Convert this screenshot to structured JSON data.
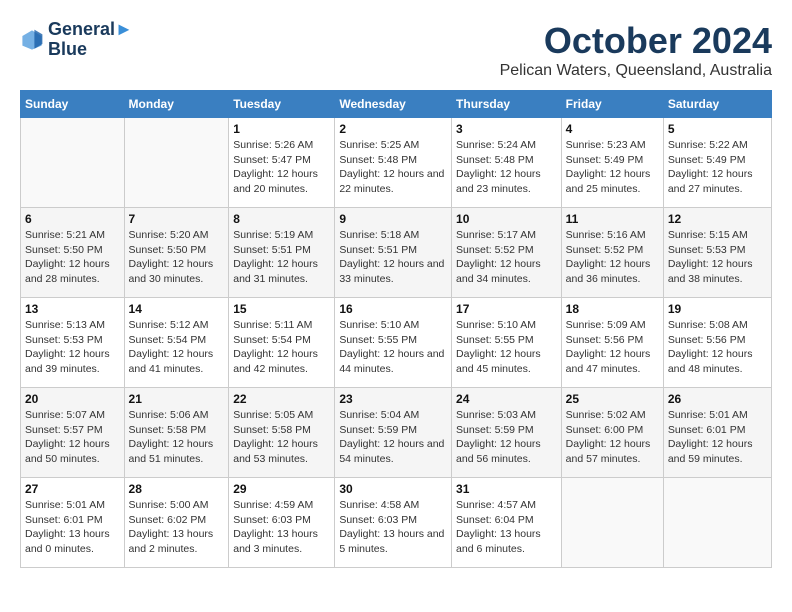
{
  "logo": {
    "line1": "General",
    "line2": "Blue"
  },
  "title": "October 2024",
  "location": "Pelican Waters, Queensland, Australia",
  "weekdays": [
    "Sunday",
    "Monday",
    "Tuesday",
    "Wednesday",
    "Thursday",
    "Friday",
    "Saturday"
  ],
  "weeks": [
    [
      {
        "day": "",
        "sunrise": "",
        "sunset": "",
        "daylight": ""
      },
      {
        "day": "",
        "sunrise": "",
        "sunset": "",
        "daylight": ""
      },
      {
        "day": "1",
        "sunrise": "Sunrise: 5:26 AM",
        "sunset": "Sunset: 5:47 PM",
        "daylight": "Daylight: 12 hours and 20 minutes."
      },
      {
        "day": "2",
        "sunrise": "Sunrise: 5:25 AM",
        "sunset": "Sunset: 5:48 PM",
        "daylight": "Daylight: 12 hours and 22 minutes."
      },
      {
        "day": "3",
        "sunrise": "Sunrise: 5:24 AM",
        "sunset": "Sunset: 5:48 PM",
        "daylight": "Daylight: 12 hours and 23 minutes."
      },
      {
        "day": "4",
        "sunrise": "Sunrise: 5:23 AM",
        "sunset": "Sunset: 5:49 PM",
        "daylight": "Daylight: 12 hours and 25 minutes."
      },
      {
        "day": "5",
        "sunrise": "Sunrise: 5:22 AM",
        "sunset": "Sunset: 5:49 PM",
        "daylight": "Daylight: 12 hours and 27 minutes."
      }
    ],
    [
      {
        "day": "6",
        "sunrise": "Sunrise: 5:21 AM",
        "sunset": "Sunset: 5:50 PM",
        "daylight": "Daylight: 12 hours and 28 minutes."
      },
      {
        "day": "7",
        "sunrise": "Sunrise: 5:20 AM",
        "sunset": "Sunset: 5:50 PM",
        "daylight": "Daylight: 12 hours and 30 minutes."
      },
      {
        "day": "8",
        "sunrise": "Sunrise: 5:19 AM",
        "sunset": "Sunset: 5:51 PM",
        "daylight": "Daylight: 12 hours and 31 minutes."
      },
      {
        "day": "9",
        "sunrise": "Sunrise: 5:18 AM",
        "sunset": "Sunset: 5:51 PM",
        "daylight": "Daylight: 12 hours and 33 minutes."
      },
      {
        "day": "10",
        "sunrise": "Sunrise: 5:17 AM",
        "sunset": "Sunset: 5:52 PM",
        "daylight": "Daylight: 12 hours and 34 minutes."
      },
      {
        "day": "11",
        "sunrise": "Sunrise: 5:16 AM",
        "sunset": "Sunset: 5:52 PM",
        "daylight": "Daylight: 12 hours and 36 minutes."
      },
      {
        "day": "12",
        "sunrise": "Sunrise: 5:15 AM",
        "sunset": "Sunset: 5:53 PM",
        "daylight": "Daylight: 12 hours and 38 minutes."
      }
    ],
    [
      {
        "day": "13",
        "sunrise": "Sunrise: 5:13 AM",
        "sunset": "Sunset: 5:53 PM",
        "daylight": "Daylight: 12 hours and 39 minutes."
      },
      {
        "day": "14",
        "sunrise": "Sunrise: 5:12 AM",
        "sunset": "Sunset: 5:54 PM",
        "daylight": "Daylight: 12 hours and 41 minutes."
      },
      {
        "day": "15",
        "sunrise": "Sunrise: 5:11 AM",
        "sunset": "Sunset: 5:54 PM",
        "daylight": "Daylight: 12 hours and 42 minutes."
      },
      {
        "day": "16",
        "sunrise": "Sunrise: 5:10 AM",
        "sunset": "Sunset: 5:55 PM",
        "daylight": "Daylight: 12 hours and 44 minutes."
      },
      {
        "day": "17",
        "sunrise": "Sunrise: 5:10 AM",
        "sunset": "Sunset: 5:55 PM",
        "daylight": "Daylight: 12 hours and 45 minutes."
      },
      {
        "day": "18",
        "sunrise": "Sunrise: 5:09 AM",
        "sunset": "Sunset: 5:56 PM",
        "daylight": "Daylight: 12 hours and 47 minutes."
      },
      {
        "day": "19",
        "sunrise": "Sunrise: 5:08 AM",
        "sunset": "Sunset: 5:56 PM",
        "daylight": "Daylight: 12 hours and 48 minutes."
      }
    ],
    [
      {
        "day": "20",
        "sunrise": "Sunrise: 5:07 AM",
        "sunset": "Sunset: 5:57 PM",
        "daylight": "Daylight: 12 hours and 50 minutes."
      },
      {
        "day": "21",
        "sunrise": "Sunrise: 5:06 AM",
        "sunset": "Sunset: 5:58 PM",
        "daylight": "Daylight: 12 hours and 51 minutes."
      },
      {
        "day": "22",
        "sunrise": "Sunrise: 5:05 AM",
        "sunset": "Sunset: 5:58 PM",
        "daylight": "Daylight: 12 hours and 53 minutes."
      },
      {
        "day": "23",
        "sunrise": "Sunrise: 5:04 AM",
        "sunset": "Sunset: 5:59 PM",
        "daylight": "Daylight: 12 hours and 54 minutes."
      },
      {
        "day": "24",
        "sunrise": "Sunrise: 5:03 AM",
        "sunset": "Sunset: 5:59 PM",
        "daylight": "Daylight: 12 hours and 56 minutes."
      },
      {
        "day": "25",
        "sunrise": "Sunrise: 5:02 AM",
        "sunset": "Sunset: 6:00 PM",
        "daylight": "Daylight: 12 hours and 57 minutes."
      },
      {
        "day": "26",
        "sunrise": "Sunrise: 5:01 AM",
        "sunset": "Sunset: 6:01 PM",
        "daylight": "Daylight: 12 hours and 59 minutes."
      }
    ],
    [
      {
        "day": "27",
        "sunrise": "Sunrise: 5:01 AM",
        "sunset": "Sunset: 6:01 PM",
        "daylight": "Daylight: 13 hours and 0 minutes."
      },
      {
        "day": "28",
        "sunrise": "Sunrise: 5:00 AM",
        "sunset": "Sunset: 6:02 PM",
        "daylight": "Daylight: 13 hours and 2 minutes."
      },
      {
        "day": "29",
        "sunrise": "Sunrise: 4:59 AM",
        "sunset": "Sunset: 6:03 PM",
        "daylight": "Daylight: 13 hours and 3 minutes."
      },
      {
        "day": "30",
        "sunrise": "Sunrise: 4:58 AM",
        "sunset": "Sunset: 6:03 PM",
        "daylight": "Daylight: 13 hours and 5 minutes."
      },
      {
        "day": "31",
        "sunrise": "Sunrise: 4:57 AM",
        "sunset": "Sunset: 6:04 PM",
        "daylight": "Daylight: 13 hours and 6 minutes."
      },
      {
        "day": "",
        "sunrise": "",
        "sunset": "",
        "daylight": ""
      },
      {
        "day": "",
        "sunrise": "",
        "sunset": "",
        "daylight": ""
      }
    ]
  ]
}
